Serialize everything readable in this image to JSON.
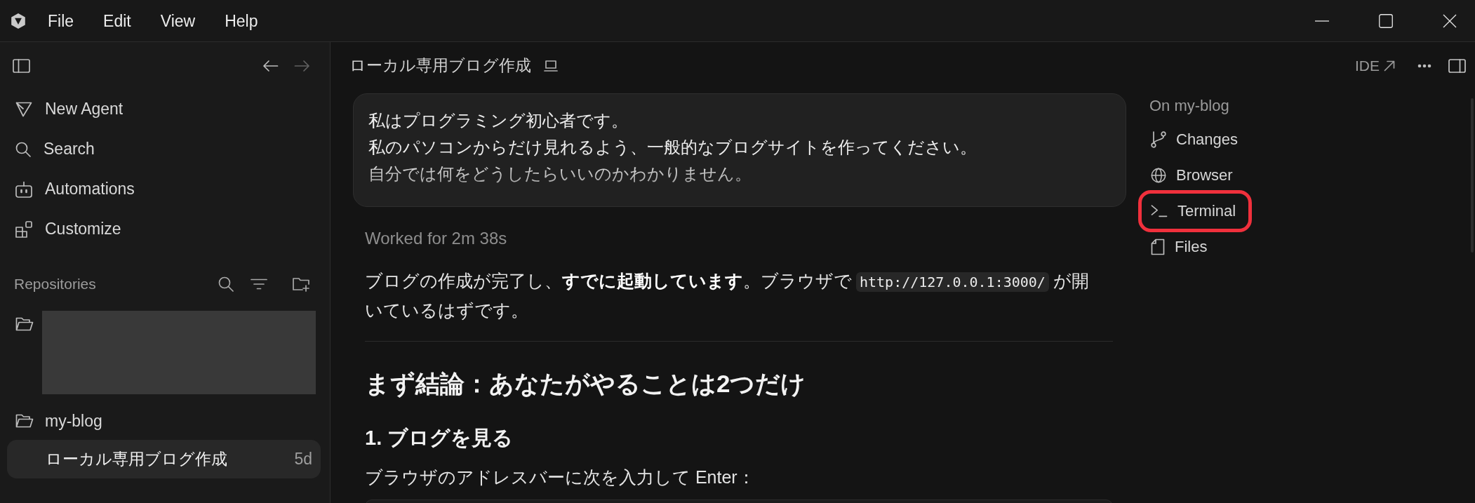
{
  "menu_bar": {
    "items": [
      "File",
      "Edit",
      "View",
      "Help"
    ]
  },
  "sidebar": {
    "history": {
      "back": {
        "disabled": false
      },
      "forward": {
        "disabled": true
      }
    },
    "nav": [
      {
        "label": "New Agent"
      },
      {
        "label": "Search"
      },
      {
        "label": "Automations"
      },
      {
        "label": "Customize"
      }
    ],
    "repositories": {
      "title": "Repositories",
      "repos": [
        {
          "redacted": true
        },
        {
          "name": "my-blog",
          "redacted": false,
          "threads": [
            {
              "title": "ローカル専用ブログ作成",
              "age": "5d",
              "selected": true
            }
          ]
        }
      ]
    }
  },
  "thread": {
    "title": "ローカル専用ブログ作成",
    "ide_label": "IDE",
    "user_message": [
      "私はプログラミング初心者です。",
      "私のパソコンからだけ見れるよう、一般的なブログサイトを作ってください。",
      "自分では何をどうしたらいいのかわかりません。"
    ],
    "worked_for": "Worked for 2m 38s",
    "response": [
      {
        "kind": "paragraph",
        "parts": [
          {
            "kind": "text",
            "text": "ブログの作成が完了し、**すでに起動しています**。ブラウザで"
          },
          {
            "kind": "code",
            "text": "http://127.0.0.1:3000/"
          },
          {
            "kind": "text",
            "text": "が開いているはずです。"
          }
        ]
      },
      {
        "kind": "divider"
      },
      {
        "kind": "heading",
        "text": "まず結論：あなたがやることは2つだけ"
      },
      {
        "kind": "subheading",
        "text": "1. ブログを見る"
      },
      {
        "kind": "paragraph",
        "parts": [
          {
            "kind": "text",
            "text": "ブラウザのアドレスバーに次を入力して Enter："
          }
        ]
      },
      {
        "kind": "code_block"
      }
    ]
  },
  "right_panel": {
    "title": "On my-blog",
    "items": [
      {
        "label": "Changes",
        "highlighted": false
      },
      {
        "label": "Browser",
        "highlighted": false
      },
      {
        "label": "Terminal",
        "highlighted": true
      },
      {
        "label": "Files",
        "highlighted": false
      }
    ]
  }
}
